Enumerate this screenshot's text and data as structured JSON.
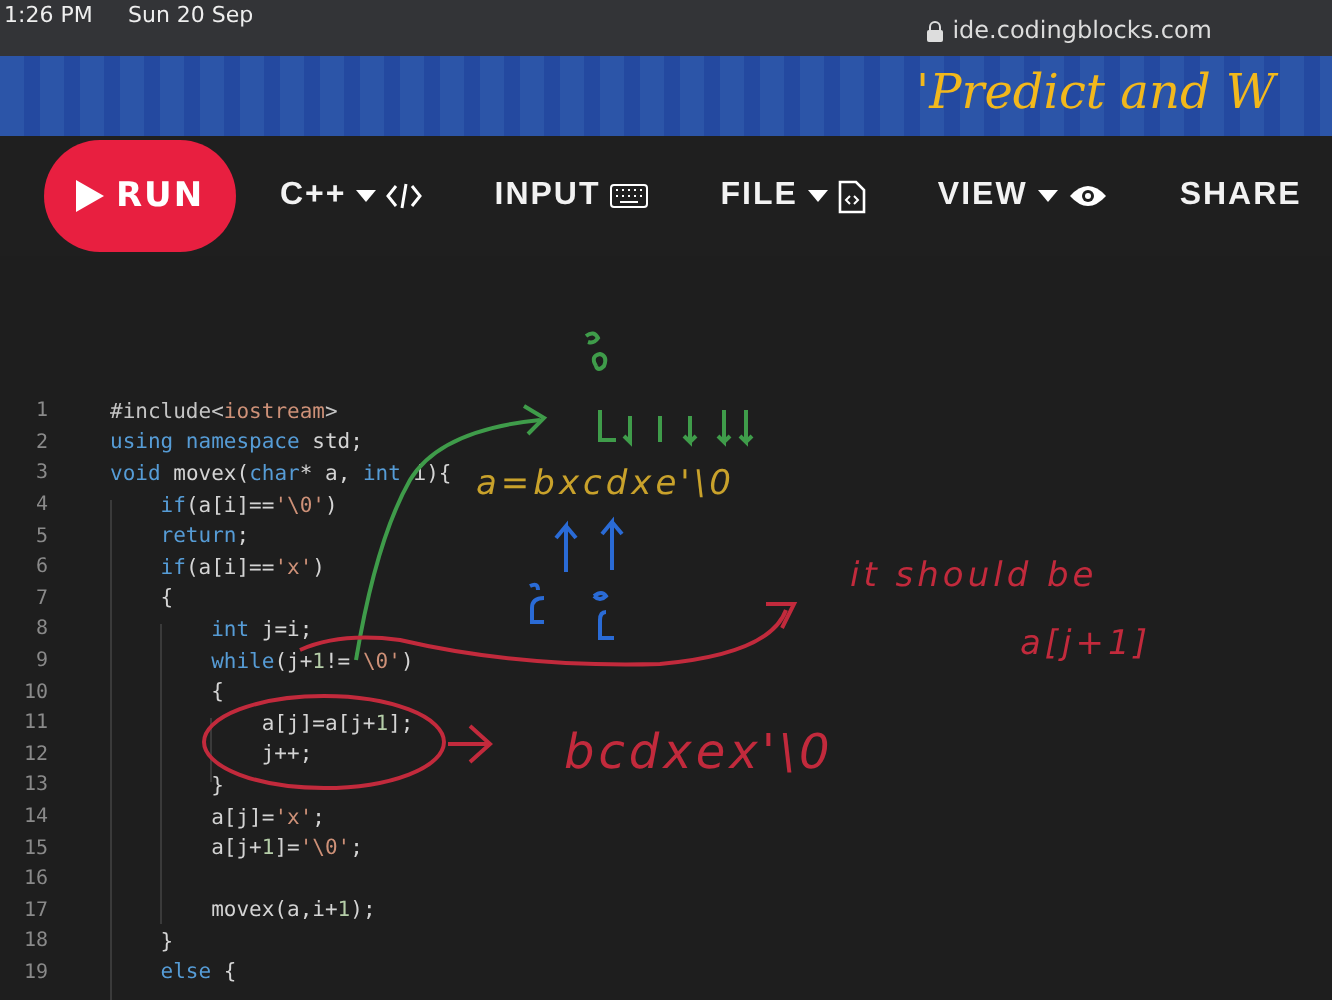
{
  "status_bar": {
    "time": "1:26 PM",
    "date": "Sun 20 Sep",
    "url": "ide.codingblocks.com"
  },
  "banner": {
    "text": "'Predict and W"
  },
  "toolbar": {
    "run": "RUN",
    "items": [
      {
        "label": "C++",
        "caret": true
      },
      {
        "label": "INPUT",
        "caret": false
      },
      {
        "label": "FILE",
        "caret": true
      },
      {
        "label": "VIEW",
        "caret": true
      },
      {
        "label": "SHARE",
        "caret": false
      }
    ]
  },
  "editor": {
    "lines": [
      {
        "number": "1",
        "tokens": [
          {
            "t": "#include<",
            "kind": "pre"
          },
          {
            "t": "iostream",
            "kind": "str"
          },
          {
            "t": ">",
            "kind": "pre"
          }
        ]
      },
      {
        "number": "2",
        "tokens": [
          {
            "t": "using namespace",
            "kind": "kw"
          },
          {
            "t": " std;",
            "kind": "plain"
          }
        ]
      },
      {
        "number": "3",
        "tokens": [
          {
            "t": "void",
            "kind": "kw"
          },
          {
            "t": " movex(",
            "kind": "plain"
          },
          {
            "t": "char",
            "kind": "kw"
          },
          {
            "t": "* a, ",
            "kind": "plain"
          },
          {
            "t": "int",
            "kind": "kw"
          },
          {
            "t": " i){",
            "kind": "plain"
          }
        ]
      },
      {
        "number": "4",
        "tokens": [
          {
            "t": "    if",
            "kind": "kw"
          },
          {
            "t": "(a[i]==",
            "kind": "plain"
          },
          {
            "t": "'\\0'",
            "kind": "str"
          },
          {
            "t": ")",
            "kind": "plain"
          }
        ]
      },
      {
        "number": "5",
        "tokens": [
          {
            "t": "    return",
            "kind": "kw"
          },
          {
            "t": ";",
            "kind": "plain"
          }
        ]
      },
      {
        "number": "6",
        "tokens": [
          {
            "t": "    if",
            "kind": "kw"
          },
          {
            "t": "(a[i]==",
            "kind": "plain"
          },
          {
            "t": "'x'",
            "kind": "str"
          },
          {
            "t": ")",
            "kind": "plain"
          }
        ]
      },
      {
        "number": "7",
        "tokens": [
          {
            "t": "    {",
            "kind": "plain"
          }
        ]
      },
      {
        "number": "8",
        "tokens": [
          {
            "t": "        int",
            "kind": "kw"
          },
          {
            "t": " j=i;",
            "kind": "plain"
          }
        ]
      },
      {
        "number": "9",
        "tokens": [
          {
            "t": "        while",
            "kind": "kw"
          },
          {
            "t": "(j+",
            "kind": "plain"
          },
          {
            "t": "1",
            "kind": "num"
          },
          {
            "t": "!=",
            "kind": "plain"
          },
          {
            "t": "'\\0'",
            "kind": "str"
          },
          {
            "t": ")",
            "kind": "plain"
          }
        ]
      },
      {
        "number": "10",
        "tokens": [
          {
            "t": "        {",
            "kind": "plain"
          }
        ]
      },
      {
        "number": "11",
        "tokens": [
          {
            "t": "            a[j]=a[j+",
            "kind": "plain"
          },
          {
            "t": "1",
            "kind": "num"
          },
          {
            "t": "];",
            "kind": "plain"
          }
        ]
      },
      {
        "number": "12",
        "tokens": [
          {
            "t": "            j++;",
            "kind": "plain"
          }
        ]
      },
      {
        "number": "13",
        "tokens": [
          {
            "t": "        }",
            "kind": "plain"
          }
        ]
      },
      {
        "number": "14",
        "tokens": [
          {
            "t": "        a[j]=",
            "kind": "plain"
          },
          {
            "t": "'x'",
            "kind": "str"
          },
          {
            "t": ";",
            "kind": "plain"
          }
        ]
      },
      {
        "number": "15",
        "tokens": [
          {
            "t": "        a[j+",
            "kind": "plain"
          },
          {
            "t": "1",
            "kind": "num"
          },
          {
            "t": "]=",
            "kind": "plain"
          },
          {
            "t": "'\\0'",
            "kind": "str"
          },
          {
            "t": ";",
            "kind": "plain"
          }
        ]
      },
      {
        "number": "16"
      },
      {
        "number": "17",
        "tokens": [
          {
            "t": "        movex(a,i+",
            "kind": "plain"
          },
          {
            "t": "1",
            "kind": "num"
          },
          {
            "t": ");",
            "kind": "plain"
          }
        ]
      },
      {
        "number": "18",
        "tokens": [
          {
            "t": "    }",
            "kind": "plain"
          }
        ]
      },
      {
        "number": "19",
        "tokens": [
          {
            "t": "    else",
            "kind": "kw"
          },
          {
            "t": " {",
            "kind": "plain"
          }
        ]
      }
    ]
  },
  "annotations": [
    {
      "text": "a=bxcdxe'\\0",
      "color": "#c9a22b"
    },
    {
      "text": "it should be",
      "color": "#c22a3c"
    },
    {
      "text": "a[j+1]",
      "color": "#c22a3c"
    },
    {
      "text": "bcdxex'\\0",
      "color": "#c22a3c"
    }
  ]
}
